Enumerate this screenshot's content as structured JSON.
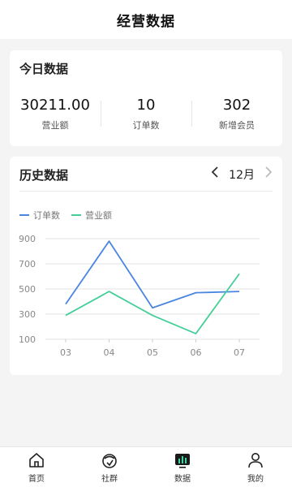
{
  "header": {
    "title": "经营数据"
  },
  "today": {
    "title": "今日数据",
    "stats": [
      {
        "value": "30211.00",
        "label": "营业额"
      },
      {
        "value": "10",
        "label": "订单数"
      },
      {
        "value": "302",
        "label": "新增会员"
      }
    ]
  },
  "history": {
    "title": "历史数据",
    "month": "12月",
    "prev_icon": "chevron-left-icon",
    "next_icon": "chevron-right-icon"
  },
  "chart_data": {
    "type": "line",
    "categories": [
      "03",
      "04",
      "05",
      "06",
      "07"
    ],
    "series": [
      {
        "name": "订单数",
        "color": "#4a86e0",
        "values": [
          380,
          880,
          350,
          470,
          480
        ]
      },
      {
        "name": "营业额",
        "color": "#45cf98",
        "values": [
          290,
          480,
          290,
          145,
          620
        ]
      }
    ],
    "yticks": [
      100,
      300,
      500,
      700,
      900
    ],
    "ylim": [
      100,
      900
    ],
    "grid": true,
    "legend_position": "top-left"
  },
  "tabbar": {
    "items": [
      {
        "label": "首页",
        "icon": "home-icon"
      },
      {
        "label": "社群",
        "icon": "community-icon"
      },
      {
        "label": "数据",
        "icon": "data-icon"
      },
      {
        "label": "我的",
        "icon": "user-icon"
      }
    ]
  }
}
